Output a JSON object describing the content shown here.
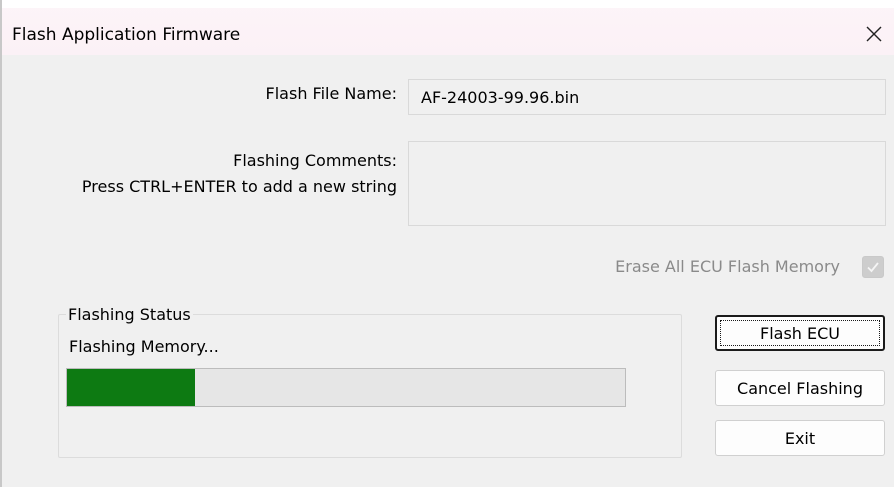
{
  "window": {
    "title": "Flash Application Firmware",
    "close_glyph": "close-icon"
  },
  "form": {
    "file_name_label": "Flash File Name:",
    "file_name_value": "AF-24003-99.96.bin",
    "comments_label_line1": "Flashing Comments:",
    "comments_label_line2": "Press CTRL+ENTER to add a new string",
    "comments_value": "",
    "erase_label": "Erase All ECU Flash Memory",
    "erase_checked": true,
    "erase_enabled": false
  },
  "status": {
    "group_title": "Flashing Status",
    "message": "Flashing Memory...",
    "progress_fraction": 0.23,
    "progress_color": "#0d7a12"
  },
  "buttons": {
    "flash": "Flash ECU",
    "cancel": "Cancel Flashing",
    "exit": "Exit"
  }
}
